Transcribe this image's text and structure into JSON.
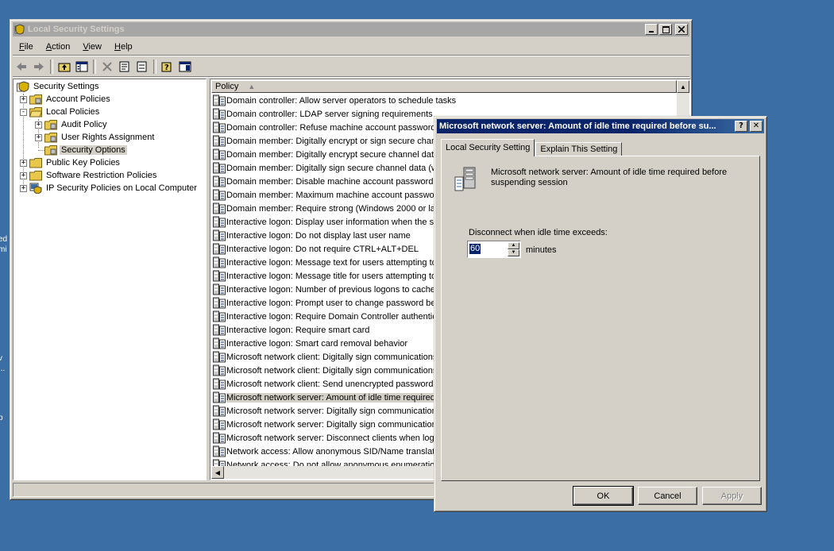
{
  "desktop": {
    "fragments": [
      "ed",
      "mi",
      "v",
      "...",
      "p"
    ]
  },
  "main_window": {
    "title": "Local Security Settings",
    "menu": [
      {
        "label": "File",
        "key": "F",
        "rest": "ile"
      },
      {
        "label": "Action",
        "key": "A",
        "rest": "ction"
      },
      {
        "label": "View",
        "key": "V",
        "rest": "iew"
      },
      {
        "label": "Help",
        "key": "H",
        "rest": "elp"
      }
    ],
    "toolbar_icons": [
      "back-icon",
      "forward-icon",
      "up-folder-icon",
      "show-hide-tree-icon",
      "delete-icon",
      "properties-icon",
      "export-list-icon",
      "help-icon",
      "console-icon"
    ],
    "tree": [
      {
        "label": "Security Settings",
        "level": 0,
        "expander": "",
        "icon": "shield"
      },
      {
        "label": "Account Policies",
        "level": 1,
        "expander": "+",
        "icon": "folder"
      },
      {
        "label": "Local Policies",
        "level": 1,
        "expander": "-",
        "icon": "folder-open"
      },
      {
        "label": "Audit Policy",
        "level": 2,
        "expander": "+",
        "icon": "folder"
      },
      {
        "label": "User Rights Assignment",
        "level": 2,
        "expander": "+",
        "icon": "folder"
      },
      {
        "label": "Security Options",
        "level": 2,
        "expander": "",
        "icon": "folder",
        "selected": true
      },
      {
        "label": "Public Key Policies",
        "level": 1,
        "expander": "+",
        "icon": "folder"
      },
      {
        "label": "Software Restriction Policies",
        "level": 1,
        "expander": "+",
        "icon": "folder"
      },
      {
        "label": "IP Security Policies on Local Computer",
        "level": 1,
        "expander": "+",
        "icon": "ipsec"
      }
    ],
    "list_header": "Policy",
    "policies": [
      "Domain controller: Allow server operators to schedule tasks",
      "Domain controller: LDAP server signing requirements",
      "Domain controller: Refuse machine account password changes",
      "Domain member: Digitally encrypt or sign secure channel data (always)",
      "Domain member: Digitally encrypt secure channel data (when possible)",
      "Domain member: Digitally sign secure channel data (when possible)",
      "Domain member: Disable machine account password changes",
      "Domain member: Maximum machine account password age",
      "Domain member: Require strong (Windows 2000 or later) session key",
      "Interactive logon: Display user information when the session is locked",
      "Interactive logon: Do not display last user name",
      "Interactive logon: Do not require CTRL+ALT+DEL",
      "Interactive logon: Message text for users attempting to log on",
      "Interactive logon: Message title for users attempting to log on",
      "Interactive logon: Number of previous logons to cache",
      "Interactive logon: Prompt user to change password before expiration",
      "Interactive logon: Require Domain Controller authentication",
      "Interactive logon: Require smart card",
      "Interactive logon: Smart card removal behavior",
      "Microsoft network client: Digitally sign communications (always)",
      "Microsoft network client: Digitally sign communications (if server agrees)",
      "Microsoft network client: Send unencrypted password to third-party SMB servers",
      "Microsoft network server: Amount of idle time required before suspending session",
      "Microsoft network server: Digitally sign communications (always)",
      "Microsoft network server: Digitally sign communications (if client agrees)",
      "Microsoft network server: Disconnect clients when logon hours expire",
      "Network access: Allow anonymous SID/Name translation",
      "Network access: Do not allow anonymous enumeration of SAM accounts"
    ],
    "selected_policy_index": 22
  },
  "dialog": {
    "title": "Microsoft network server: Amount of idle time required before su...",
    "help_glyph": "?",
    "close_glyph": "✕",
    "tabs": [
      "Local Security Setting",
      "Explain This Setting"
    ],
    "active_tab": 0,
    "description": "Microsoft network server: Amount of idle time required before suspending session",
    "idle_label": "Disconnect when idle time exceeds:",
    "idle_value": "60",
    "units": "minutes",
    "buttons": {
      "ok": "OK",
      "cancel": "Cancel",
      "apply": "Apply"
    }
  }
}
